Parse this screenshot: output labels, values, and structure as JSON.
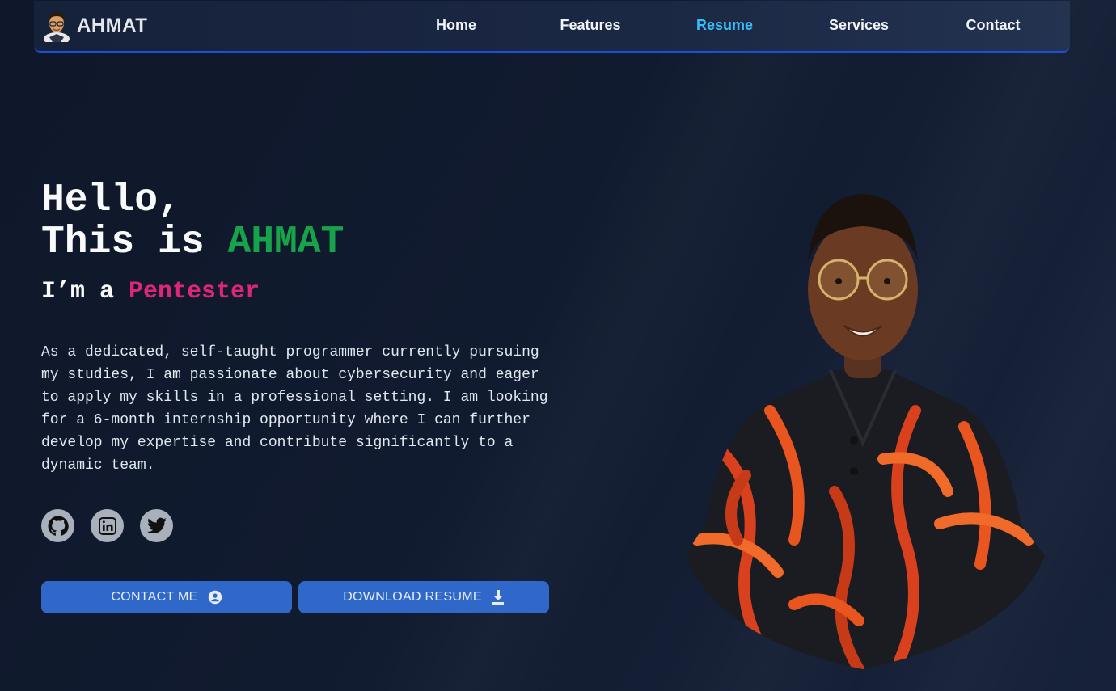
{
  "nav": {
    "brand": "AHMAT",
    "links": [
      {
        "label": "Home"
      },
      {
        "label": "Features"
      },
      {
        "label": "Resume",
        "active": true
      },
      {
        "label": "Services"
      },
      {
        "label": "Contact"
      }
    ]
  },
  "hero": {
    "greeting": "Hello,",
    "intro_prefix": "This is ",
    "name": "AHMAT",
    "role_prefix": "I’m a ",
    "role": "Pentester",
    "bio": "As a dedicated, self-taught programmer currently pursuing my studies, I am passionate about cybersecurity and eager to apply my skills in a professional setting. I am looking for a 6-month internship opportunity where I can further develop my expertise and contribute significantly to a dynamic team."
  },
  "socials": [
    {
      "icon": "github-icon"
    },
    {
      "icon": "linkedin-icon"
    },
    {
      "icon": "twitter-icon"
    }
  ],
  "buttons": {
    "contact_label": "CONTACT ME",
    "contact_icon": "user-circle-icon",
    "download_label": "DOWNLOAD RESUME",
    "download_icon": "download-icon"
  },
  "colors": {
    "background": "#0f172a",
    "name_accent": "#16a34a",
    "role_accent": "#db2777",
    "nav_active": "#38bdf8",
    "button": "#3068c9"
  }
}
